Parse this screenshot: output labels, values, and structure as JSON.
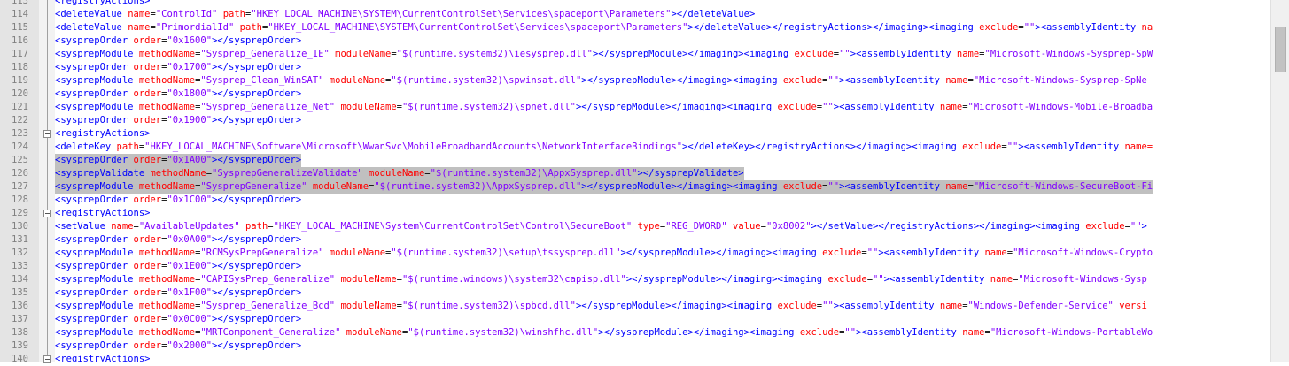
{
  "editor": {
    "first_line": 113,
    "highlighted_lines": [
      125,
      126,
      127
    ],
    "fold_lines": [
      123,
      129,
      140
    ],
    "lines": [
      [
        [
          "t",
          "<"
        ],
        [
          "t",
          "registryActions"
        ],
        [
          "t",
          ">"
        ]
      ],
      [
        [
          "t",
          "<"
        ],
        [
          "t",
          "deleteValue "
        ],
        [
          "a",
          "name"
        ],
        [
          "p",
          "="
        ],
        [
          "v",
          "\"ControlId\""
        ],
        [
          "p",
          " "
        ],
        [
          "a",
          "path"
        ],
        [
          "p",
          "="
        ],
        [
          "v",
          "\"HKEY_LOCAL_MACHINE\\SYSTEM\\CurrentControlSet\\Services\\spaceport\\Parameters\""
        ],
        [
          "t",
          "></"
        ],
        [
          "t",
          "deleteValue"
        ],
        [
          "t",
          ">"
        ]
      ],
      [
        [
          "t",
          "<"
        ],
        [
          "t",
          "deleteValue "
        ],
        [
          "a",
          "name"
        ],
        [
          "p",
          "="
        ],
        [
          "v",
          "\"PrimordialId\""
        ],
        [
          "p",
          " "
        ],
        [
          "a",
          "path"
        ],
        [
          "p",
          "="
        ],
        [
          "v",
          "\"HKEY_LOCAL_MACHINE\\SYSTEM\\CurrentControlSet\\Services\\spaceport\\Parameters\""
        ],
        [
          "t",
          "></deleteValue></registryActions></imaging><imaging "
        ],
        [
          "a",
          "exclude"
        ],
        [
          "p",
          "="
        ],
        [
          "v",
          "\"\""
        ],
        [
          "t",
          "><assemblyIdentity "
        ],
        [
          "a",
          "na"
        ]
      ],
      [
        [
          "t",
          "<"
        ],
        [
          "t",
          "sysprepOrder "
        ],
        [
          "a",
          "order"
        ],
        [
          "p",
          "="
        ],
        [
          "v",
          "\"0x1600\""
        ],
        [
          "t",
          "></sysprepOrder>"
        ]
      ],
      [
        [
          "t",
          "<"
        ],
        [
          "t",
          "sysprepModule "
        ],
        [
          "a",
          "methodName"
        ],
        [
          "p",
          "="
        ],
        [
          "v",
          "\"Sysprep_Generalize_IE\""
        ],
        [
          "p",
          " "
        ],
        [
          "a",
          "moduleName"
        ],
        [
          "p",
          "="
        ],
        [
          "v",
          "\"$(runtime.system32)\\iesysprep.dll\""
        ],
        [
          "t",
          "></sysprepModule></imaging><imaging "
        ],
        [
          "a",
          "exclude"
        ],
        [
          "p",
          "="
        ],
        [
          "v",
          "\"\""
        ],
        [
          "t",
          "><assemblyIdentity "
        ],
        [
          "a",
          "name"
        ],
        [
          "p",
          "="
        ],
        [
          "v",
          "\"Microsoft-Windows-Sysprep-SpW"
        ]
      ],
      [
        [
          "t",
          "<"
        ],
        [
          "t",
          "sysprepOrder "
        ],
        [
          "a",
          "order"
        ],
        [
          "p",
          "="
        ],
        [
          "v",
          "\"0x1700\""
        ],
        [
          "t",
          "></sysprepOrder>"
        ]
      ],
      [
        [
          "t",
          "<"
        ],
        [
          "t",
          "sysprepModule "
        ],
        [
          "a",
          "methodName"
        ],
        [
          "p",
          "="
        ],
        [
          "v",
          "\"Sysprep_Clean_WinSAT\""
        ],
        [
          "p",
          " "
        ],
        [
          "a",
          "moduleName"
        ],
        [
          "p",
          "="
        ],
        [
          "v",
          "\"$(runtime.system32)\\spwinsat.dll\""
        ],
        [
          "t",
          "></sysprepModule></imaging><imaging "
        ],
        [
          "a",
          "exclude"
        ],
        [
          "p",
          "="
        ],
        [
          "v",
          "\"\""
        ],
        [
          "t",
          "><assemblyIdentity "
        ],
        [
          "a",
          "name"
        ],
        [
          "p",
          "="
        ],
        [
          "v",
          "\"Microsoft-Windows-Sysprep-SpNe"
        ]
      ],
      [
        [
          "t",
          "<"
        ],
        [
          "t",
          "sysprepOrder "
        ],
        [
          "a",
          "order"
        ],
        [
          "p",
          "="
        ],
        [
          "v",
          "\"0x1800\""
        ],
        [
          "t",
          "></sysprepOrder>"
        ]
      ],
      [
        [
          "t",
          "<"
        ],
        [
          "t",
          "sysprepModule "
        ],
        [
          "a",
          "methodName"
        ],
        [
          "p",
          "="
        ],
        [
          "v",
          "\"Sysprep_Generalize_Net\""
        ],
        [
          "p",
          " "
        ],
        [
          "a",
          "moduleName"
        ],
        [
          "p",
          "="
        ],
        [
          "v",
          "\"$(runtime.system32)\\spnet.dll\""
        ],
        [
          "t",
          "></sysprepModule></imaging><imaging "
        ],
        [
          "a",
          "exclude"
        ],
        [
          "p",
          "="
        ],
        [
          "v",
          "\"\""
        ],
        [
          "t",
          "><assemblyIdentity "
        ],
        [
          "a",
          "name"
        ],
        [
          "p",
          "="
        ],
        [
          "v",
          "\"Microsoft-Windows-Mobile-Broadba"
        ]
      ],
      [
        [
          "t",
          "<"
        ],
        [
          "t",
          "sysprepOrder "
        ],
        [
          "a",
          "order"
        ],
        [
          "p",
          "="
        ],
        [
          "v",
          "\"0x1900\""
        ],
        [
          "t",
          "></sysprepOrder>"
        ]
      ],
      [
        [
          "t",
          "<"
        ],
        [
          "t",
          "registryActions"
        ],
        [
          "t",
          ">"
        ]
      ],
      [
        [
          "t",
          "<"
        ],
        [
          "t",
          "deleteKey "
        ],
        [
          "a",
          "path"
        ],
        [
          "p",
          "="
        ],
        [
          "v",
          "\"HKEY_LOCAL_MACHINE\\Software\\Microsoft\\WwanSvc\\MobileBroadbandAccounts\\NetworkInterfaceBindings\""
        ],
        [
          "t",
          "></deleteKey></registryActions></imaging><imaging "
        ],
        [
          "a",
          "exclude"
        ],
        [
          "p",
          "="
        ],
        [
          "v",
          "\"\""
        ],
        [
          "t",
          "><assemblyIdentity "
        ],
        [
          "a",
          "name="
        ]
      ],
      [
        [
          "t",
          "<"
        ],
        [
          "t",
          "sysprepOrder "
        ],
        [
          "a",
          "order"
        ],
        [
          "p",
          "="
        ],
        [
          "v",
          "\"0x1A00\""
        ],
        [
          "t",
          "></sysprepOrder>"
        ]
      ],
      [
        [
          "t",
          "<"
        ],
        [
          "t",
          "sysprepValidate "
        ],
        [
          "a",
          "methodName"
        ],
        [
          "p",
          "="
        ],
        [
          "v",
          "\"SysprepGeneralizeValidate\""
        ],
        [
          "p",
          " "
        ],
        [
          "a",
          "moduleName"
        ],
        [
          "p",
          "="
        ],
        [
          "v",
          "\"$(runtime.system32)\\AppxSysprep.dll\""
        ],
        [
          "t",
          "></sysprepValidate>"
        ]
      ],
      [
        [
          "t",
          "<"
        ],
        [
          "t",
          "sysprepModule "
        ],
        [
          "a",
          "methodName"
        ],
        [
          "p",
          "="
        ],
        [
          "v",
          "\"SysprepGeneralize\""
        ],
        [
          "p",
          " "
        ],
        [
          "a",
          "moduleName"
        ],
        [
          "p",
          "="
        ],
        [
          "v",
          "\"$(runtime.system32)\\AppxSysprep.dll\""
        ],
        [
          "t",
          "></sysprepModule></imaging><imaging "
        ],
        [
          "a",
          "exclude"
        ],
        [
          "p",
          "="
        ],
        [
          "v",
          "\"\""
        ],
        [
          "t",
          "><assemblyIdentity "
        ],
        [
          "a",
          "name"
        ],
        [
          "p",
          "="
        ],
        [
          "v",
          "\"Microsoft-Windows-SecureBoot-Fi"
        ]
      ],
      [
        [
          "t",
          "<"
        ],
        [
          "t",
          "sysprepOrder "
        ],
        [
          "a",
          "order"
        ],
        [
          "p",
          "="
        ],
        [
          "v",
          "\"0x1C00\""
        ],
        [
          "t",
          "></sysprepOrder>"
        ]
      ],
      [
        [
          "t",
          "<"
        ],
        [
          "t",
          "registryActions"
        ],
        [
          "t",
          ">"
        ]
      ],
      [
        [
          "t",
          "<"
        ],
        [
          "t",
          "setValue "
        ],
        [
          "a",
          "name"
        ],
        [
          "p",
          "="
        ],
        [
          "v",
          "\"AvailableUpdates\""
        ],
        [
          "p",
          " "
        ],
        [
          "a",
          "path"
        ],
        [
          "p",
          "="
        ],
        [
          "v",
          "\"HKEY_LOCAL_MACHINE\\System\\CurrentControlSet\\Control\\SecureBoot\""
        ],
        [
          "p",
          " "
        ],
        [
          "a",
          "type"
        ],
        [
          "p",
          "="
        ],
        [
          "v",
          "\"REG_DWORD\""
        ],
        [
          "p",
          " "
        ],
        [
          "a",
          "value"
        ],
        [
          "p",
          "="
        ],
        [
          "v",
          "\"0x8002\""
        ],
        [
          "t",
          "></setValue></registryActions></imaging><imaging "
        ],
        [
          "a",
          "exclude"
        ],
        [
          "p",
          "="
        ],
        [
          "v",
          "\"\""
        ],
        [
          "t",
          ">"
        ]
      ],
      [
        [
          "t",
          "<"
        ],
        [
          "t",
          "sysprepOrder "
        ],
        [
          "a",
          "order"
        ],
        [
          "p",
          "="
        ],
        [
          "v",
          "\"0x0A00\""
        ],
        [
          "t",
          "></sysprepOrder>"
        ]
      ],
      [
        [
          "t",
          "<"
        ],
        [
          "t",
          "sysprepModule "
        ],
        [
          "a",
          "methodName"
        ],
        [
          "p",
          "="
        ],
        [
          "v",
          "\"RCMSysPrepGeneralize\""
        ],
        [
          "p",
          " "
        ],
        [
          "a",
          "moduleName"
        ],
        [
          "p",
          "="
        ],
        [
          "v",
          "\"$(runtime.system32)\\setup\\tssysprep.dll\""
        ],
        [
          "t",
          "></sysprepModule></imaging><imaging "
        ],
        [
          "a",
          "exclude"
        ],
        [
          "p",
          "="
        ],
        [
          "v",
          "\"\""
        ],
        [
          "t",
          "><assemblyIdentity "
        ],
        [
          "a",
          "name"
        ],
        [
          "p",
          "="
        ],
        [
          "v",
          "\"Microsoft-Windows-Crypto"
        ]
      ],
      [
        [
          "t",
          "<"
        ],
        [
          "t",
          "sysprepOrder "
        ],
        [
          "a",
          "order"
        ],
        [
          "p",
          "="
        ],
        [
          "v",
          "\"0x1E00\""
        ],
        [
          "t",
          "></sysprepOrder>"
        ]
      ],
      [
        [
          "t",
          "<"
        ],
        [
          "t",
          "sysprepModule "
        ],
        [
          "a",
          "methodName"
        ],
        [
          "p",
          "="
        ],
        [
          "v",
          "\"CAPISysPrep_Generalize\""
        ],
        [
          "p",
          " "
        ],
        [
          "a",
          "moduleName"
        ],
        [
          "p",
          "="
        ],
        [
          "v",
          "\"$(runtime.windows)\\system32\\capisp.dll\""
        ],
        [
          "t",
          "></sysprepModule></imaging><imaging "
        ],
        [
          "a",
          "exclude"
        ],
        [
          "p",
          "="
        ],
        [
          "v",
          "\"\""
        ],
        [
          "t",
          "><assemblyIdentity "
        ],
        [
          "a",
          "name"
        ],
        [
          "p",
          "="
        ],
        [
          "v",
          "\"Microsoft-Windows-Sysp"
        ]
      ],
      [
        [
          "t",
          "<"
        ],
        [
          "t",
          "sysprepOrder "
        ],
        [
          "a",
          "order"
        ],
        [
          "p",
          "="
        ],
        [
          "v",
          "\"0x1F00\""
        ],
        [
          "t",
          "></sysprepOrder>"
        ]
      ],
      [
        [
          "t",
          "<"
        ],
        [
          "t",
          "sysprepModule "
        ],
        [
          "a",
          "methodName"
        ],
        [
          "p",
          "="
        ],
        [
          "v",
          "\"Sysprep_Generalize_Bcd\""
        ],
        [
          "p",
          " "
        ],
        [
          "a",
          "moduleName"
        ],
        [
          "p",
          "="
        ],
        [
          "v",
          "\"$(runtime.system32)\\spbcd.dll\""
        ],
        [
          "t",
          "></sysprepModule></imaging><imaging "
        ],
        [
          "a",
          "exclude"
        ],
        [
          "p",
          "="
        ],
        [
          "v",
          "\"\""
        ],
        [
          "t",
          "><assemblyIdentity "
        ],
        [
          "a",
          "name"
        ],
        [
          "p",
          "="
        ],
        [
          "v",
          "\"Windows-Defender-Service\""
        ],
        [
          "p",
          " "
        ],
        [
          "a",
          "versi"
        ]
      ],
      [
        [
          "t",
          "<"
        ],
        [
          "t",
          "sysprepOrder "
        ],
        [
          "a",
          "order"
        ],
        [
          "p",
          "="
        ],
        [
          "v",
          "\"0x0C00\""
        ],
        [
          "t",
          "></sysprepOrder>"
        ]
      ],
      [
        [
          "t",
          "<"
        ],
        [
          "t",
          "sysprepModule "
        ],
        [
          "a",
          "methodName"
        ],
        [
          "p",
          "="
        ],
        [
          "v",
          "\"MRTComponent_Generalize\""
        ],
        [
          "p",
          " "
        ],
        [
          "a",
          "moduleName"
        ],
        [
          "p",
          "="
        ],
        [
          "v",
          "\"$(runtime.system32)\\winshfhc.dll\""
        ],
        [
          "t",
          "></sysprepModule></imaging><imaging "
        ],
        [
          "a",
          "exclude"
        ],
        [
          "p",
          "="
        ],
        [
          "v",
          "\"\""
        ],
        [
          "t",
          "><assemblyIdentity "
        ],
        [
          "a",
          "name"
        ],
        [
          "p",
          "="
        ],
        [
          "v",
          "\"Microsoft-Windows-PortableWo"
        ]
      ],
      [
        [
          "t",
          "<"
        ],
        [
          "t",
          "sysprepOrder "
        ],
        [
          "a",
          "order"
        ],
        [
          "p",
          "="
        ],
        [
          "v",
          "\"0x2000\""
        ],
        [
          "t",
          "></sysprepOrder>"
        ]
      ],
      [
        [
          "t",
          "<"
        ],
        [
          "t",
          "registryActions"
        ],
        [
          "t",
          ">"
        ]
      ]
    ]
  }
}
